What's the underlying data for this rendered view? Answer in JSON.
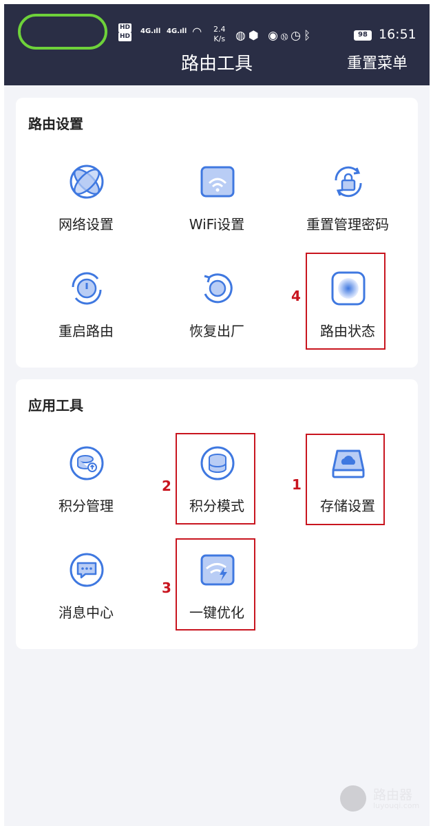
{
  "status_bar": {
    "hd1": "HD",
    "hd2": "HD",
    "sim1": "4G",
    "sim2": "4G",
    "speed_value": "2.4",
    "speed_unit": "K/s",
    "battery": "98",
    "time": "16:51"
  },
  "header": {
    "title": "路由工具",
    "action": "重置菜单"
  },
  "sections": [
    {
      "title": "路由设置",
      "items": [
        {
          "label": "网络设置",
          "icon": "globe-icon"
        },
        {
          "label": "WiFi设置",
          "icon": "wifi-icon"
        },
        {
          "label": "重置管理密码",
          "icon": "lock-reset-icon"
        },
        {
          "label": "重启路由",
          "icon": "power-restart-icon"
        },
        {
          "label": "恢复出厂",
          "icon": "factory-reset-icon"
        },
        {
          "label": "路由状态",
          "icon": "router-status-icon"
        }
      ]
    },
    {
      "title": "应用工具",
      "items": [
        {
          "label": "积分管理",
          "icon": "points-manage-icon"
        },
        {
          "label": "积分模式",
          "icon": "points-mode-icon"
        },
        {
          "label": "存储设置",
          "icon": "cloud-storage-icon"
        },
        {
          "label": "消息中心",
          "icon": "message-icon"
        },
        {
          "label": "一键优化",
          "icon": "optimize-icon"
        }
      ]
    }
  ],
  "annotations": {
    "mark_1": "1",
    "mark_2": "2",
    "mark_3": "3",
    "mark_4": "4",
    "color": "#c8141e"
  },
  "watermark": {
    "text": "路由器",
    "url": "luyouqi.com"
  },
  "colors": {
    "header_bg": "#2a2e45",
    "accent": "#3f78e0",
    "icon_fill": "#b9cdf5"
  }
}
